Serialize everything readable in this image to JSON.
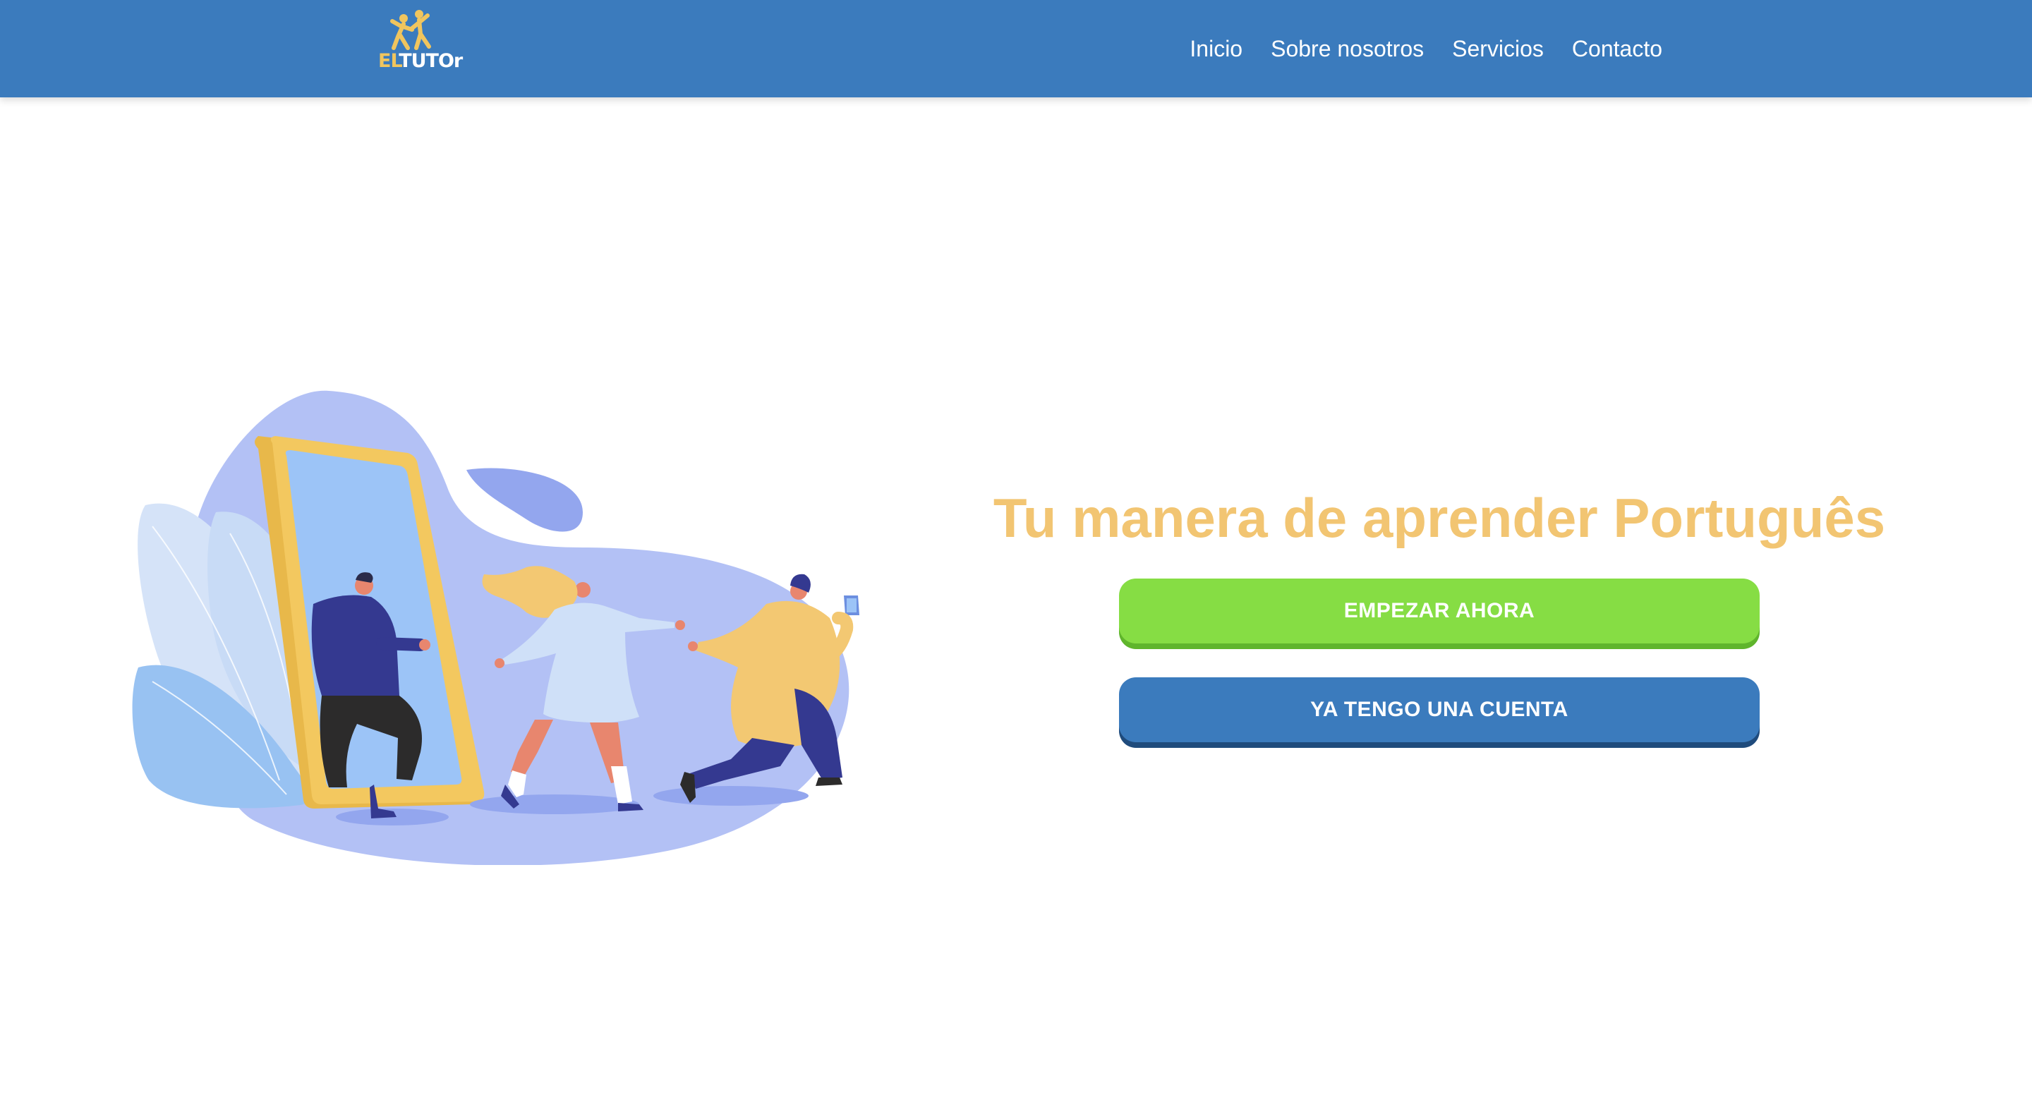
{
  "brand": {
    "logo_el": "EL",
    "logo_tutor": "TUTOr",
    "logo_icon": "people-jumping-icon"
  },
  "nav": {
    "items": [
      {
        "label": "Inicio"
      },
      {
        "label": "Sobre nosotros"
      },
      {
        "label": "Servicios"
      },
      {
        "label": "Contacto"
      }
    ]
  },
  "hero": {
    "title": "Tu manera de aprender Português",
    "illustration": "people-running-out-of-phone-illustration",
    "start_button": "EMPEZAR AHORA",
    "login_button": "YA TENGO UNA CUENTA"
  },
  "colors": {
    "navbar": "#3b7bbd",
    "title": "#f2c572",
    "start_button": "#86dd44",
    "login_button": "#3b7bbd"
  }
}
